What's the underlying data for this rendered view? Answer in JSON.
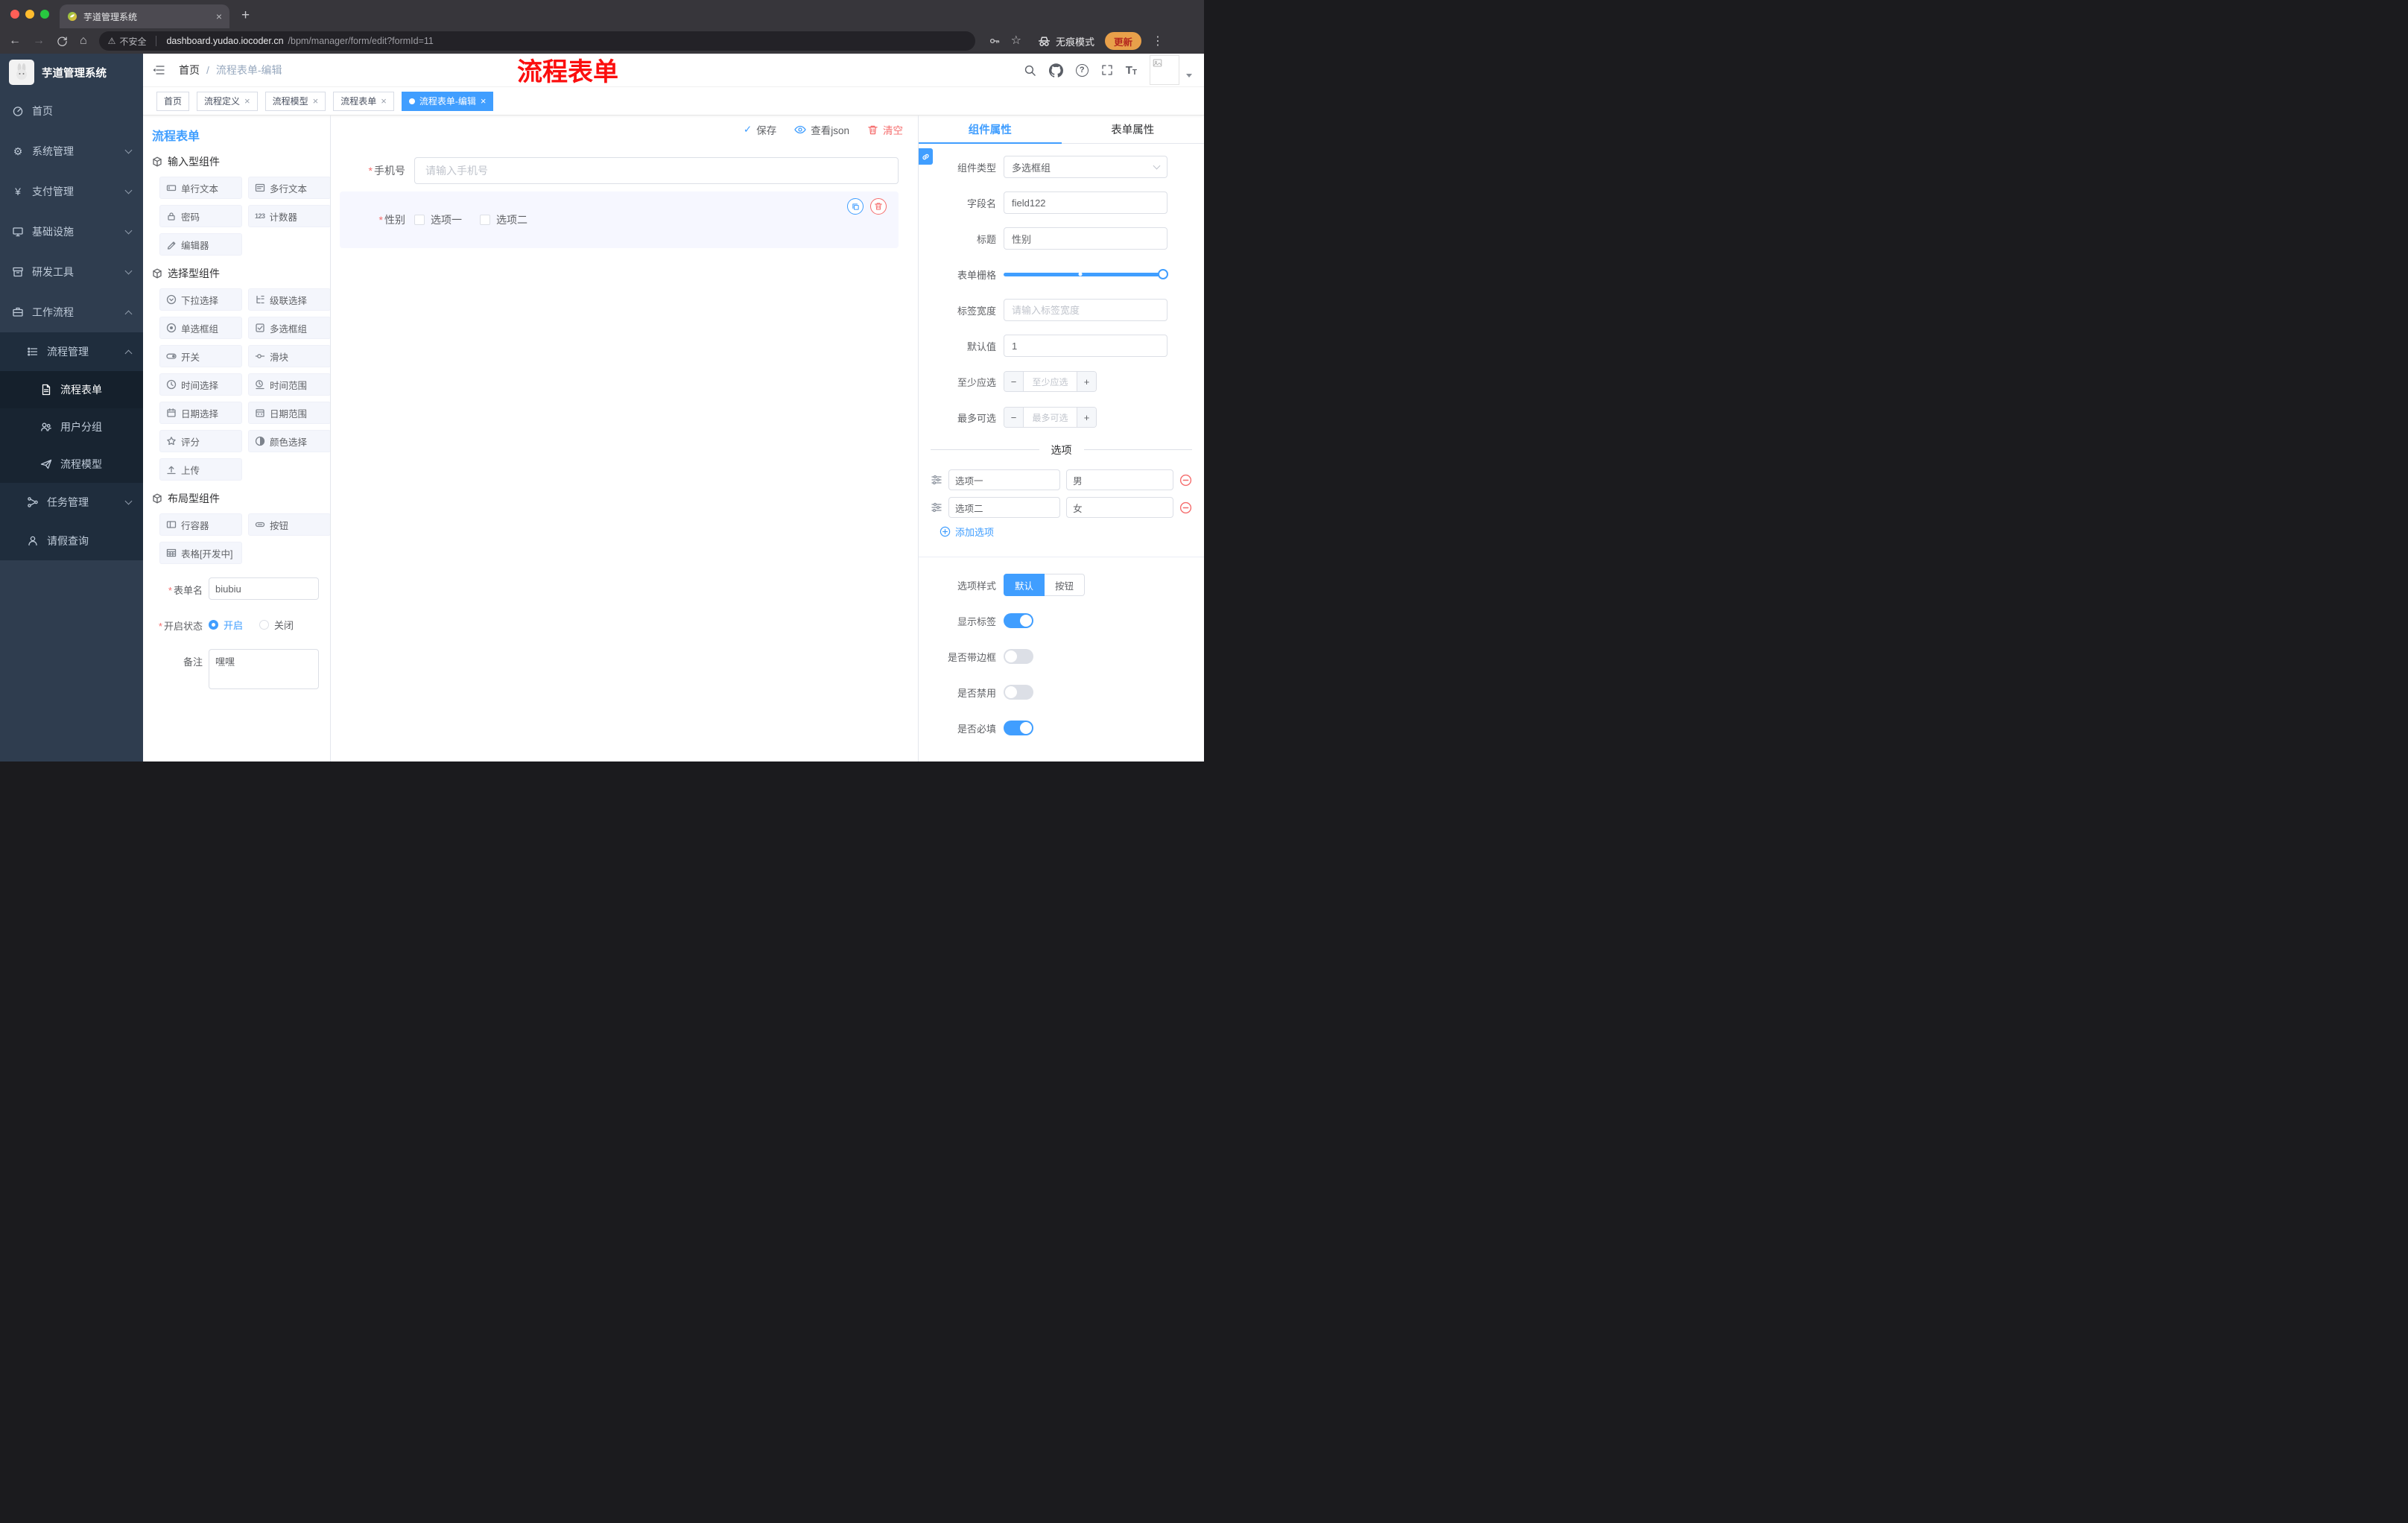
{
  "icons": {
    "close": "×",
    "plus": "+",
    "minus": "−",
    "check": "✓",
    "back": "←",
    "forward": "→",
    "home": "⌂",
    "more": "⋮",
    "star": "☆",
    "warning": "⚠",
    "question": "?",
    "required": "*",
    "counter": "123",
    "font_large": "T",
    "font_small": "T",
    "yen": "¥",
    "gear": "⚙"
  },
  "browser": {
    "tab_title": "芋道管理系统",
    "security_label": "不安全",
    "url_host": "dashboard.yudao.iocoder.cn",
    "url_path": "/bpm/manager/form/edit?formId=11",
    "incognito_label": "无痕模式",
    "update_label": "更新"
  },
  "sidebar": {
    "logo_title": "芋道管理系统",
    "items": [
      {
        "label": "首页"
      },
      {
        "label": "系统管理"
      },
      {
        "label": "支付管理"
      },
      {
        "label": "基础设施"
      },
      {
        "label": "研发工具"
      },
      {
        "label": "工作流程"
      },
      {
        "label": "流程管理"
      },
      {
        "label": "流程表单"
      },
      {
        "label": "用户分组"
      },
      {
        "label": "流程模型"
      },
      {
        "label": "任务管理"
      },
      {
        "label": "请假查询"
      }
    ]
  },
  "header": {
    "breadcrumb_home": "首页",
    "breadcrumb_sep": "/",
    "breadcrumb_current": "流程表单-编辑",
    "annotation": "流程表单"
  },
  "tags": [
    {
      "label": "首页"
    },
    {
      "label": "流程定义"
    },
    {
      "label": "流程模型"
    },
    {
      "label": "流程表单"
    },
    {
      "label": "流程表单-编辑"
    }
  ],
  "palette": {
    "title": "流程表单",
    "group_input": {
      "title": "输入型组件",
      "items": [
        {
          "label": "单行文本"
        },
        {
          "label": "多行文本"
        },
        {
          "label": "密码"
        },
        {
          "label": "计数器"
        },
        {
          "label": "编辑器"
        }
      ]
    },
    "group_select": {
      "title": "选择型组件",
      "items": [
        {
          "label": "下拉选择"
        },
        {
          "label": "级联选择"
        },
        {
          "label": "单选框组"
        },
        {
          "label": "多选框组"
        },
        {
          "label": "开关"
        },
        {
          "label": "滑块"
        },
        {
          "label": "时间选择"
        },
        {
          "label": "时间范围"
        },
        {
          "label": "日期选择"
        },
        {
          "label": "日期范围"
        },
        {
          "label": "评分"
        },
        {
          "label": "颜色选择"
        },
        {
          "label": "上传"
        }
      ]
    },
    "group_layout": {
      "title": "布局型组件",
      "items": [
        {
          "label": "行容器"
        },
        {
          "label": "按钮"
        },
        {
          "label": "表格[开发中]"
        }
      ]
    },
    "form": {
      "name_label": "表单名",
      "name_value": "biubiu",
      "status_label": "开启状态",
      "status_on": "开启",
      "status_off": "关闭",
      "remark_label": "备注",
      "remark_value": "嘿嘿"
    }
  },
  "canvas": {
    "save_label": "保存",
    "view_json_label": "查看json",
    "clear_label": "清空",
    "phone_label": "手机号",
    "phone_placeholder": "请输入手机号",
    "gender_label": "性别",
    "gender_option1": "选项一",
    "gender_option2": "选项二"
  },
  "inspector": {
    "tab_component": "组件属性",
    "tab_form": "表单属性",
    "component_type_label": "组件类型",
    "component_type_value": "多选框组",
    "field_name_label": "字段名",
    "field_name_value": "field122",
    "title_label": "标题",
    "title_value": "性别",
    "grid_label": "表单栅格",
    "label_width_label": "标签宽度",
    "label_width_placeholder": "请输入标签宽度",
    "default_label": "默认值",
    "default_value": "1",
    "min_label": "至少应选",
    "min_placeholder": "至少应选",
    "max_label": "最多可选",
    "max_placeholder": "最多可选",
    "options_divider": "选项",
    "options": [
      {
        "name": "选项一",
        "value": "男"
      },
      {
        "name": "选项二",
        "value": "女"
      }
    ],
    "add_option_label": "添加选项",
    "style_label": "选项样式",
    "style_default": "默认",
    "style_button": "按钮",
    "show_label_label": "显示标签",
    "border_label": "是否带边框",
    "disabled_label": "是否禁用",
    "required_label": "是否必填"
  }
}
